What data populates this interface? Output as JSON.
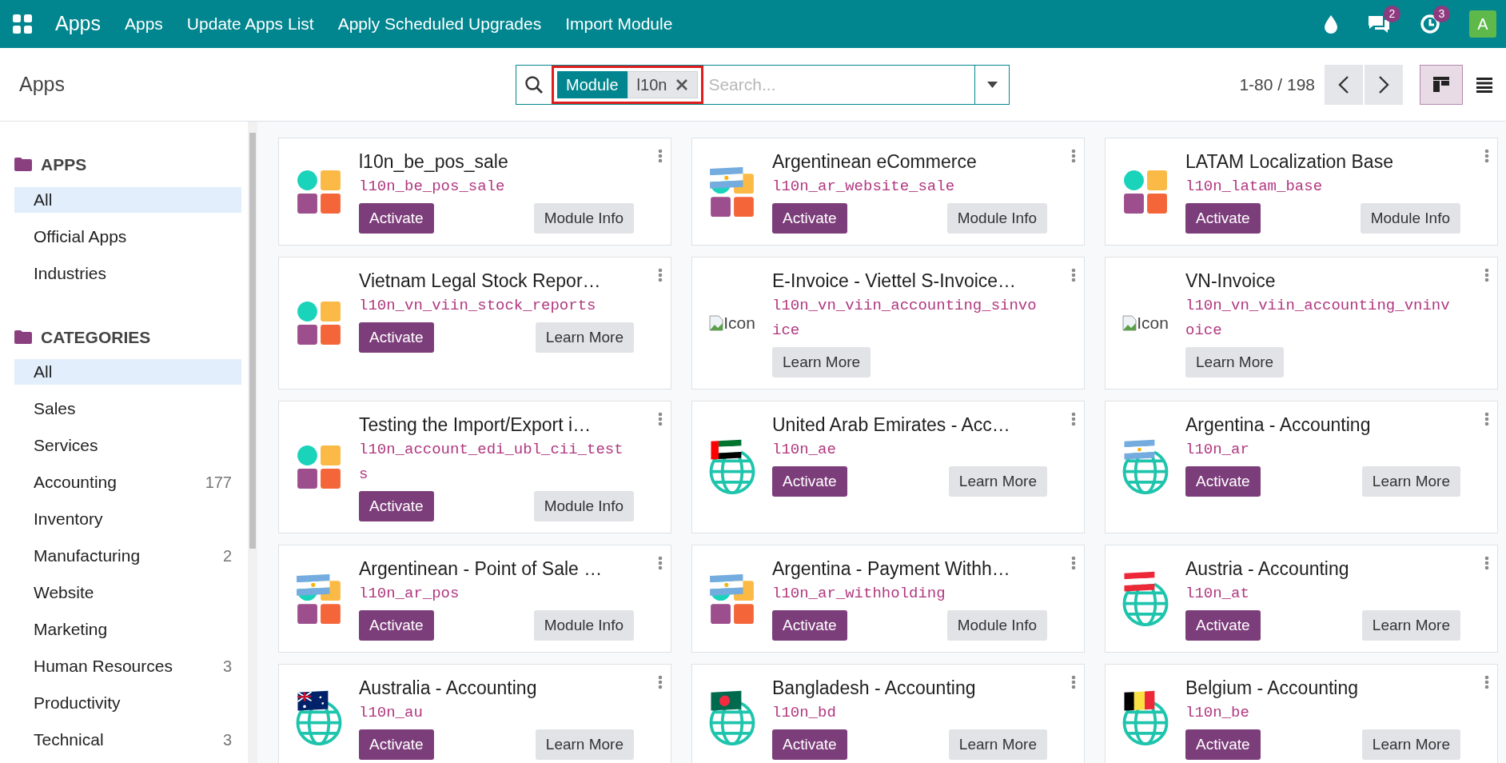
{
  "navbar": {
    "brand": "Apps",
    "menu": [
      "Apps",
      "Update Apps List",
      "Apply Scheduled Upgrades",
      "Import Module"
    ],
    "systray": [
      {
        "kind": "drop"
      },
      {
        "kind": "chat",
        "count": "2"
      },
      {
        "kind": "activity",
        "count": "3"
      },
      {
        "kind": "avatar",
        "label": "A"
      }
    ]
  },
  "control_panel": {
    "breadcrumb": "Apps",
    "search": {
      "facets": [
        {
          "label": "Module",
          "value": "l10n",
          "highlighted": true
        }
      ],
      "placeholder": "Search..."
    },
    "pager": "1-80 / 198",
    "views": [
      {
        "kind": "kanban",
        "selected": true
      },
      {
        "kind": "list",
        "selected": false
      }
    ]
  },
  "sidebar": {
    "sections": [
      {
        "title": "APPS",
        "items": [
          {
            "label": "All",
            "selected": true
          },
          {
            "label": "Official Apps",
            "selected": false
          },
          {
            "label": "Industries",
            "selected": false
          }
        ]
      },
      {
        "title": "CATEGORIES",
        "items": [
          {
            "label": "All",
            "selected": true
          },
          {
            "label": "Sales",
            "selected": false
          },
          {
            "label": "Services",
            "selected": false
          },
          {
            "label": "Accounting",
            "count": "177",
            "selected": false
          },
          {
            "label": "Inventory",
            "selected": false
          },
          {
            "label": "Manufacturing",
            "count": "2",
            "selected": false
          },
          {
            "label": "Website",
            "selected": false
          },
          {
            "label": "Marketing",
            "selected": false
          },
          {
            "label": "Human Resources",
            "count": "3",
            "selected": false
          },
          {
            "label": "Productivity",
            "selected": false
          },
          {
            "label": "Technical",
            "count": "3",
            "selected": false
          }
        ]
      }
    ]
  },
  "cards": [
    {
      "title": "l10n_be_pos_sale",
      "code": "l10n_be_pos_sale",
      "icon": {
        "kind": "shapes"
      },
      "actions": [
        {
          "label": "Activate",
          "kind": "primary"
        },
        {
          "label": "Module Info",
          "kind": "secondary"
        }
      ]
    },
    {
      "title": "Argentinean eCommerce",
      "code": "l10n_ar_website_sale",
      "icon": {
        "kind": "flag_shapes",
        "flag": {
          "kind": "ar"
        }
      },
      "actions": [
        {
          "label": "Activate",
          "kind": "primary"
        },
        {
          "label": "Module Info",
          "kind": "secondary"
        }
      ]
    },
    {
      "title": "LATAM Localization Base",
      "code": "l10n_latam_base",
      "icon": {
        "kind": "shapes"
      },
      "actions": [
        {
          "label": "Activate",
          "kind": "primary"
        },
        {
          "label": "Module Info",
          "kind": "secondary"
        }
      ]
    },
    {
      "title": "Vietnam Legal Stock Repor…",
      "code": "l10n_vn_viin_stock_reports",
      "icon": {
        "kind": "shapes"
      },
      "actions": [
        {
          "label": "Activate",
          "kind": "primary"
        },
        {
          "label": "Learn More",
          "kind": "secondary"
        }
      ]
    },
    {
      "title": "E-Invoice - Viettel S-Invoice…",
      "code": "l10n_vn_viin_accounting_sinvoice",
      "icon": {
        "kind": "broken",
        "alt": "Icon"
      },
      "actions": [
        {
          "label": "Learn More",
          "kind": "secondary"
        }
      ]
    },
    {
      "title": "VN-Invoice",
      "code": "l10n_vn_viin_accounting_vninvoice",
      "icon": {
        "kind": "broken",
        "alt": "Icon"
      },
      "actions": [
        {
          "label": "Learn More",
          "kind": "secondary"
        }
      ]
    },
    {
      "title": "Testing the Import/Export i…",
      "code": "l10n_account_edi_ubl_cii_tests",
      "icon": {
        "kind": "shapes"
      },
      "actions": [
        {
          "label": "Activate",
          "kind": "primary"
        },
        {
          "label": "Module Info",
          "kind": "secondary"
        }
      ]
    },
    {
      "title": "United Arab Emirates - Acc…",
      "code": "l10n_ae",
      "icon": {
        "kind": "flag_globe",
        "flag": {
          "kind": "ae"
        }
      },
      "actions": [
        {
          "label": "Activate",
          "kind": "primary"
        },
        {
          "label": "Learn More",
          "kind": "secondary"
        }
      ]
    },
    {
      "title": "Argentina - Accounting",
      "code": "l10n_ar",
      "icon": {
        "kind": "flag_globe",
        "flag": {
          "kind": "ar"
        }
      },
      "actions": [
        {
          "label": "Activate",
          "kind": "primary"
        },
        {
          "label": "Learn More",
          "kind": "secondary"
        }
      ]
    },
    {
      "title": "Argentinean - Point of Sale …",
      "code": "l10n_ar_pos",
      "icon": {
        "kind": "flag_shapes",
        "flag": {
          "kind": "ar"
        }
      },
      "actions": [
        {
          "label": "Activate",
          "kind": "primary"
        },
        {
          "label": "Module Info",
          "kind": "secondary"
        }
      ]
    },
    {
      "title": "Argentina - Payment Withh…",
      "code": "l10n_ar_withholding",
      "icon": {
        "kind": "flag_shapes",
        "flag": {
          "kind": "ar"
        }
      },
      "actions": [
        {
          "label": "Activate",
          "kind": "primary"
        },
        {
          "label": "Module Info",
          "kind": "secondary"
        }
      ]
    },
    {
      "title": "Austria - Accounting",
      "code": "l10n_at",
      "icon": {
        "kind": "flag_globe",
        "flag": {
          "kind": "at"
        }
      },
      "actions": [
        {
          "label": "Activate",
          "kind": "primary"
        },
        {
          "label": "Learn More",
          "kind": "secondary"
        }
      ]
    },
    {
      "title": "Australia - Accounting",
      "code": "l10n_au",
      "icon": {
        "kind": "flag_globe",
        "flag": {
          "kind": "au"
        }
      },
      "actions": [
        {
          "label": "Activate",
          "kind": "primary"
        },
        {
          "label": "Learn More",
          "kind": "secondary"
        }
      ]
    },
    {
      "title": "Bangladesh - Accounting",
      "code": "l10n_bd",
      "icon": {
        "kind": "flag_globe",
        "flag": {
          "kind": "bd"
        }
      },
      "actions": [
        {
          "label": "Activate",
          "kind": "primary"
        },
        {
          "label": "Learn More",
          "kind": "secondary"
        }
      ]
    },
    {
      "title": "Belgium - Accounting",
      "code": "l10n_be",
      "icon": {
        "kind": "flag_globe",
        "flag": {
          "kind": "be"
        }
      },
      "actions": [
        {
          "label": "Activate",
          "kind": "primary"
        },
        {
          "label": "Learn More",
          "kind": "secondary"
        }
      ]
    }
  ]
}
